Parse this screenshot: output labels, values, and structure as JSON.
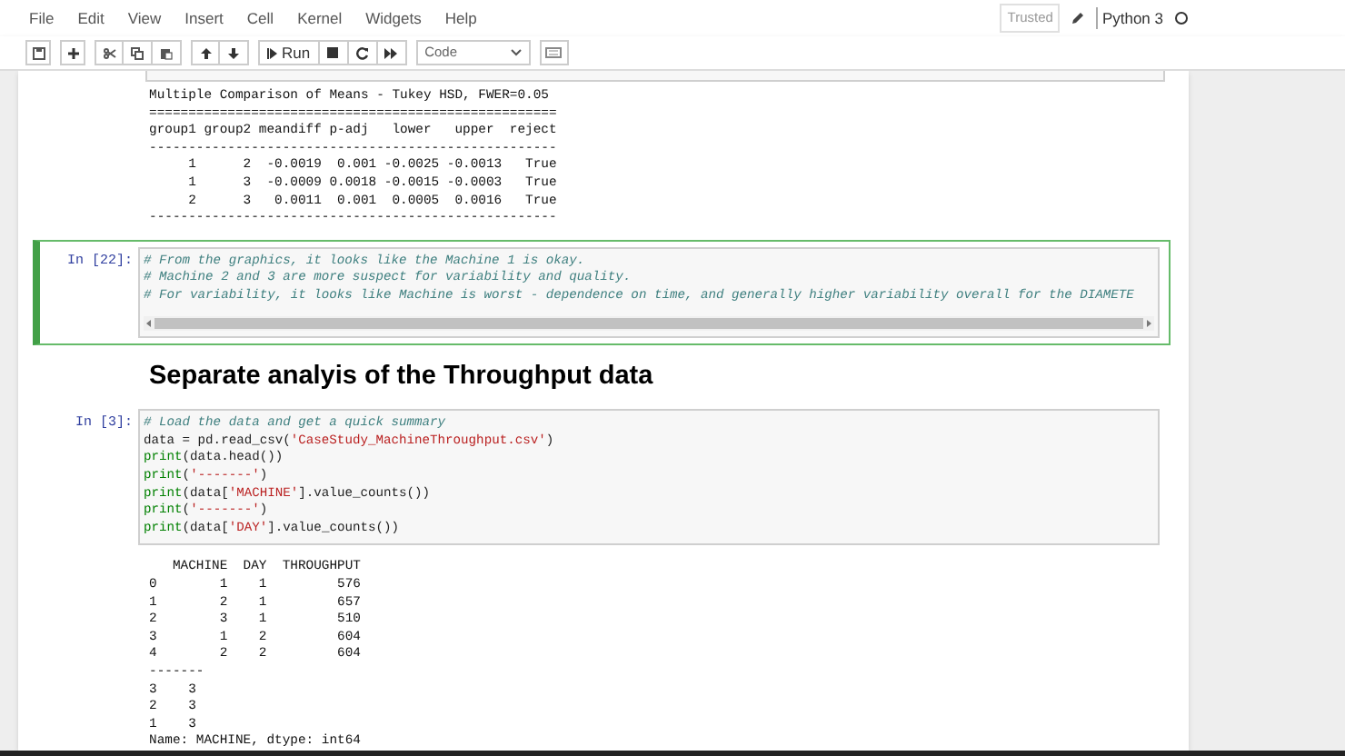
{
  "menu": [
    {
      "label": "File"
    },
    {
      "label": "Edit"
    },
    {
      "label": "View"
    },
    {
      "label": "Insert"
    },
    {
      "label": "Cell"
    },
    {
      "label": "Kernel"
    },
    {
      "label": "Widgets"
    },
    {
      "label": "Help"
    }
  ],
  "kernel_status": {
    "trusted": "Trusted",
    "kernel": "Python 3"
  },
  "toolbar": {
    "run": "Run",
    "cell_type": "Code"
  },
  "cells": [
    {
      "kind": "output",
      "lines": [
        "Multiple Comparison of Means - Tukey HSD, FWER=0.05",
        "====================================================",
        "group1 group2 meandiff p-adj   lower   upper  reject",
        "----------------------------------------------------",
        "     1      2  -0.0019  0.001 -0.0025 -0.0013   True",
        "     1      3  -0.0009 0.0018 -0.0015 -0.0003   True",
        "     2      3   0.0011  0.001  0.0005  0.0016   True",
        "----------------------------------------------------"
      ]
    },
    {
      "kind": "code",
      "prompt": "In [22]:",
      "selected": true,
      "scrollbar": true,
      "lines": [
        [
          {
            "kind": "comment",
            "text": "# From the graphics, it looks like the Machine 1 is okay."
          }
        ],
        [
          {
            "kind": "comment",
            "text": "# Machine 2 and 3 are more suspect for variability and quality."
          }
        ],
        [
          {
            "kind": "comment",
            "text": "# For variability, it looks like Machine is worst - dependence on time, and generally higher variability overall for the DIAMETE"
          }
        ]
      ]
    },
    {
      "kind": "heading",
      "text": "Separate analyis of the Throughput data"
    },
    {
      "kind": "code",
      "prompt": "In [3]:",
      "selected": false,
      "scrollbar": false,
      "lines": [
        [
          {
            "kind": "comment",
            "text": "# Load the data and get a quick summary"
          }
        ],
        [
          {
            "kind": "plain",
            "text": "data = pd.read_csv("
          },
          {
            "kind": "string",
            "text": "'CaseStudy_MachineThroughput.csv'"
          },
          {
            "kind": "plain",
            "text": ")"
          }
        ],
        [
          {
            "kind": "builtin",
            "text": "print"
          },
          {
            "kind": "plain",
            "text": "(data.head())"
          }
        ],
        [
          {
            "kind": "builtin",
            "text": "print"
          },
          {
            "kind": "plain",
            "text": "("
          },
          {
            "kind": "string",
            "text": "'-------'"
          },
          {
            "kind": "plain",
            "text": ")"
          }
        ],
        [
          {
            "kind": "builtin",
            "text": "print"
          },
          {
            "kind": "plain",
            "text": "(data["
          },
          {
            "kind": "string",
            "text": "'MACHINE'"
          },
          {
            "kind": "plain",
            "text": "].value_counts())"
          }
        ],
        [
          {
            "kind": "builtin",
            "text": "print"
          },
          {
            "kind": "plain",
            "text": "("
          },
          {
            "kind": "string",
            "text": "'-------'"
          },
          {
            "kind": "plain",
            "text": ")"
          }
        ],
        [
          {
            "kind": "builtin",
            "text": "print"
          },
          {
            "kind": "plain",
            "text": "(data["
          },
          {
            "kind": "string",
            "text": "'DAY'"
          },
          {
            "kind": "plain",
            "text": "].value_counts())"
          }
        ]
      ]
    },
    {
      "kind": "output",
      "lines": [
        "   MACHINE  DAY  THROUGHPUT",
        "0        1    1         576",
        "1        2    1         657",
        "2        3    1         510",
        "3        1    2         604",
        "4        2    2         604",
        "-------",
        "3    3",
        "2    3",
        "1    3",
        "Name: MACHINE, dtype: int64"
      ]
    }
  ]
}
